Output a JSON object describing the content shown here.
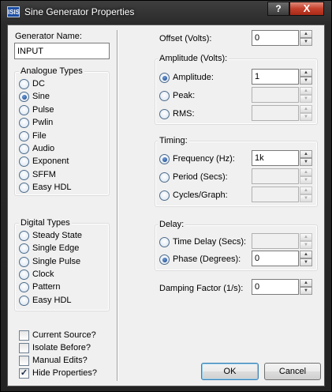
{
  "window": {
    "icon_text": "ISIS",
    "title": "Sine Generator Properties",
    "help_label": "?",
    "close_label": "X"
  },
  "generator": {
    "label": "Generator Name:",
    "value": "INPUT"
  },
  "analogue": {
    "title": "Analogue Types",
    "items": [
      {
        "label": "DC",
        "selected": false
      },
      {
        "label": "Sine",
        "selected": true
      },
      {
        "label": "Pulse",
        "selected": false
      },
      {
        "label": "Pwlin",
        "selected": false
      },
      {
        "label": "File",
        "selected": false
      },
      {
        "label": "Audio",
        "selected": false
      },
      {
        "label": "Exponent",
        "selected": false
      },
      {
        "label": "SFFM",
        "selected": false
      },
      {
        "label": "Easy HDL",
        "selected": false
      }
    ]
  },
  "digital": {
    "title": "Digital Types",
    "items": [
      {
        "label": "Steady State",
        "selected": false
      },
      {
        "label": "Single Edge",
        "selected": false
      },
      {
        "label": "Single Pulse",
        "selected": false
      },
      {
        "label": "Clock",
        "selected": false
      },
      {
        "label": "Pattern",
        "selected": false
      },
      {
        "label": "Easy HDL",
        "selected": false
      }
    ]
  },
  "options": [
    {
      "label": "Current Source?",
      "checked": false
    },
    {
      "label": "Isolate Before?",
      "checked": false
    },
    {
      "label": "Manual Edits?",
      "checked": false
    },
    {
      "label": "Hide Properties?",
      "checked": true
    }
  ],
  "check_mark": "✓",
  "offset": {
    "label": "Offset (Volts):",
    "value": "0"
  },
  "amplitude": {
    "title": "Amplitude (Volts):",
    "amplitude": {
      "label": "Amplitude:",
      "value": "1",
      "selected": true
    },
    "peak": {
      "label": "Peak:",
      "value": "",
      "selected": false
    },
    "rms": {
      "label": "RMS:",
      "value": "",
      "selected": false
    }
  },
  "timing": {
    "title": "Timing:",
    "frequency": {
      "label": "Frequency (Hz):",
      "value": "1k",
      "selected": true
    },
    "period": {
      "label": "Period (Secs):",
      "value": "",
      "selected": false
    },
    "cycles": {
      "label": "Cycles/Graph:",
      "value": "",
      "selected": false
    }
  },
  "delay": {
    "title": "Delay:",
    "time_delay": {
      "label": "Time Delay (Secs):",
      "value": "",
      "selected": false
    },
    "phase": {
      "label": "Phase (Degrees):",
      "value": "0",
      "selected": true
    }
  },
  "damping": {
    "label": "Damping Factor (1/s):",
    "value": "0"
  },
  "buttons": {
    "ok": "OK",
    "cancel": "Cancel"
  },
  "spin_up": "▲",
  "spin_down": "▼"
}
